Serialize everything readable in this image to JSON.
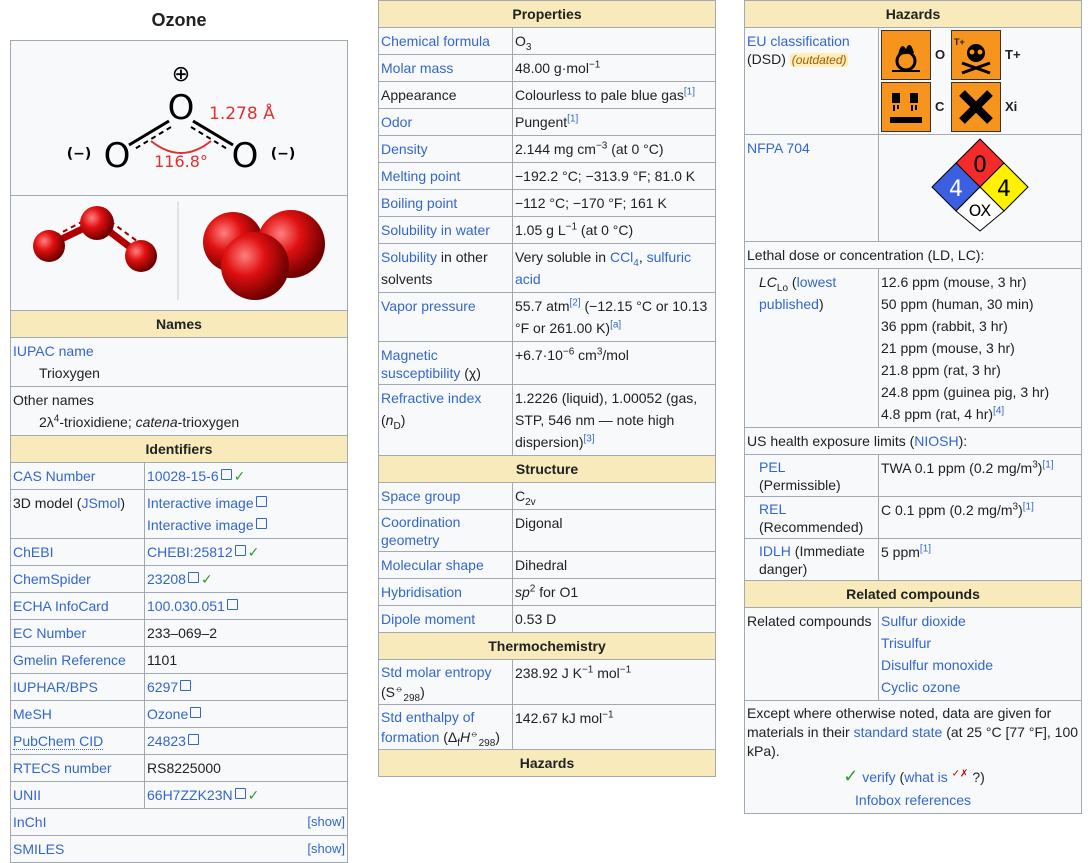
{
  "col1": {
    "title": "Ozone",
    "diagram": {
      "charge_pos": "⊕",
      "charge_neg_left": "(−)",
      "charge_neg_right": "(−)",
      "atom": "O",
      "bond_length": "1.278 Å",
      "angle": "116.8°"
    },
    "names_header": "Names",
    "iupac_label": "IUPAC name",
    "iupac_value": "Trioxygen",
    "other_names_label": "Other names",
    "other_names_a": "2λ",
    "other_names_a_sup": "4",
    "other_names_b": "-trioxidiene; ",
    "other_names_c": "catena",
    "other_names_d": "-trioxygen",
    "identifiers_header": "Identifiers",
    "rows": [
      {
        "label": "CAS Number",
        "value": "10028-15-6",
        "link": true,
        "check": true
      },
      {
        "label": "ChEBI",
        "value": "CHEBI:25812",
        "link": true,
        "check": true
      },
      {
        "label": "ChemSpider",
        "value": "23208",
        "link": true,
        "check": true
      },
      {
        "label": "ECHA InfoCard",
        "value": "100.030.051",
        "link": true,
        "check": false
      },
      {
        "label": "EC Number",
        "value": "233–069–2",
        "link": false,
        "check": false
      },
      {
        "label": "Gmelin Reference",
        "value": "1101",
        "link": false,
        "check": false
      },
      {
        "label": "IUPHAR/BPS",
        "value": "6297",
        "link": true,
        "check": false
      },
      {
        "label": "MeSH",
        "value": "Ozone",
        "link": true,
        "check": false
      },
      {
        "label": "PubChem CID",
        "value": "24823",
        "link": true,
        "check": false
      },
      {
        "label": "RTECS number",
        "value": "RS8225000",
        "link": false,
        "check": false
      },
      {
        "label": "UNII",
        "value": "66H7ZZK23N",
        "link": true,
        "check": true
      }
    ],
    "model_label_a": "3D model (",
    "model_label_link": "JSmol",
    "model_label_b": ")",
    "model_value_1": "Interactive image",
    "model_value_2": "Interactive image",
    "inchi_label": "InChI",
    "smiles_label": "SMILES",
    "show_label": "[show]"
  },
  "col2": {
    "properties_header": "Properties",
    "formula_label": "Chemical formula",
    "formula_value": "O",
    "formula_sub": "3",
    "molar_label": "Molar mass",
    "molar_value": "48.00 g·mol",
    "molar_sup": "−1",
    "appearance_label": "Appearance",
    "appearance_value": "Colourless to pale blue gas",
    "appearance_ref": "[1]",
    "odor_label": "Odor",
    "odor_value": "Pungent",
    "odor_ref": "[1]",
    "density_label": "Density",
    "density_a": "2.144 mg cm",
    "density_sup": "−3",
    "density_b": " (at 0 °C)",
    "melting_label": "Melting point",
    "melting_value": "−192.2 °C; −313.9 °F; 81.0 K",
    "boiling_label": "Boiling point",
    "boiling_value": "−112 °C; −170 °F; 161 K",
    "solw_label": "Solubility in water",
    "solw_a": "1.05 g L",
    "solw_sup": "−1",
    "solw_b": " (at 0 °C)",
    "solo_label_link": "Solubility",
    "solo_label_rest": " in other solvents",
    "solo_a": "Very soluble in ",
    "solo_ccl": "CCl",
    "solo_sub": "4",
    "solo_b": ", ",
    "solo_c": "sulfuric acid",
    "vapor_label": "Vapor pressure",
    "vapor_a": "55.7 atm",
    "vapor_ref": "[2]",
    "vapor_b": " (−12.15 °C or 10.13 °F or 261.00 K)",
    "vapor_ref2": "[a]",
    "mag_label": "Magnetic susceptibility",
    "mag_sym": " (χ)",
    "mag_a": "+6.7·10",
    "mag_sup": "−6",
    "mag_b": " cm",
    "mag_sup2": "3",
    "mag_c": "/mol",
    "ri_label": "Refractive index",
    "ri_sym_a": "(",
    "ri_sym_n": "n",
    "ri_sym_sub": "D",
    "ri_sym_b": ")",
    "ri_value": "1.2226 (liquid), 1.00052 (gas, STP, 546 nm — note high dispersion)",
    "ri_ref": "[3]",
    "structure_header": "Structure",
    "sg_label": "Space group",
    "sg_value": "C",
    "sg_sub": "2v",
    "coord_label": "Coordination geometry",
    "coord_value": "Digonal",
    "shape_label": "Molecular shape",
    "shape_value": "Dihedral",
    "hyb_label": "Hybridisation",
    "hyb_sp": "sp",
    "hyb_sup": "2",
    "hyb_b": " for O1",
    "dipole_label": "Dipole moment",
    "dipole_value": "0.53 D",
    "thermo_header": "Thermochemistry",
    "entropy_label_a": "Std molar entropy",
    "entropy_label_b": " (S",
    "entropy_sup": "⦵",
    "entropy_sub": "298",
    "entropy_label_c": ")",
    "entropy_a": "238.92 J K",
    "entropy_sup2": "−1",
    "entropy_b": " mol",
    "entropy_sup3": "−1",
    "enthalpy_label_a": "Std enthalpy of formation",
    "enthalpy_label_b": " (Δ",
    "enthalpy_sub_f": "f",
    "enthalpy_h": "H",
    "enthalpy_sup": "⦵",
    "enthalpy_sub": "298",
    "enthalpy_label_c": ")",
    "enthalpy_a": "142.67 kJ mol",
    "enthalpy_sup2": "−1",
    "hazards_header": "Hazards"
  },
  "col3": {
    "hazards_header": "Hazards",
    "eu_label_link": "EU classification",
    "eu_label_b": "(DSD)",
    "eu_outdated": "(outdated)",
    "haz_o": "O",
    "haz_tplus": "T+",
    "haz_c": "C",
    "haz_xi": "Xi",
    "haz_tplus_small": "T+",
    "nfpa_label": "NFPA 704",
    "nfpa_health": "4",
    "nfpa_fire": "0",
    "nfpa_reactivity": "4",
    "nfpa_special": "OX",
    "lethal_label": "Lethal dose or concentration (LD, LC):",
    "lclo_a": "LC",
    "lclo_sub": "Lo",
    "lclo_link": "lowest published",
    "lclo_values": [
      "12.6 ppm (mouse, 3 hr)",
      "50 ppm (human, 30 min)",
      "36 ppm (rabbit, 3 hr)",
      "21 ppm (mouse, 3 hr)",
      "21.8 ppm (rat, 3 hr)",
      "24.8 ppm (guinea pig, 3 hr)",
      "4.8 ppm (rat, 4 hr)"
    ],
    "lclo_ref": "[4]",
    "us_label_a": "US health exposure limits (",
    "us_label_link": "NIOSH",
    "us_label_b": "):",
    "pel_label_link": "PEL",
    "pel_label_b": "(Permissible)",
    "pel_a": "TWA 0.1 ppm (0.2 mg/m",
    "pel_sup": "3",
    "pel_b": ")",
    "pel_ref": "[1]",
    "rel_label_link": "REL",
    "rel_label_b": "(Recommended)",
    "rel_a": "C 0.1 ppm (0.2 mg/m",
    "rel_sup": "3",
    "rel_b": ")",
    "rel_ref": "[1]",
    "idlh_label_link": "IDLH",
    "idlh_label_b": " (Immediate danger)",
    "idlh_a": "5 ppm",
    "idlh_ref": "[1]",
    "related_header": "Related compounds",
    "related_label": "Related compounds",
    "related_values": [
      "Sulfur dioxide",
      "Trisulfur",
      "Disulfur monoxide",
      "Cyclic ozone"
    ],
    "foot_a": "Except where otherwise noted, data are given for materials in their ",
    "foot_link": "standard state",
    "foot_b": " (at 25 °C [77 °F], 100 kPa).",
    "verify_check": "✓",
    "verify_link": "verify",
    "verify_b": " (",
    "verify_what": "what is",
    "verify_marks": "✓✗",
    "verify_c": " ?)",
    "infobox_refs": "Infobox references"
  }
}
